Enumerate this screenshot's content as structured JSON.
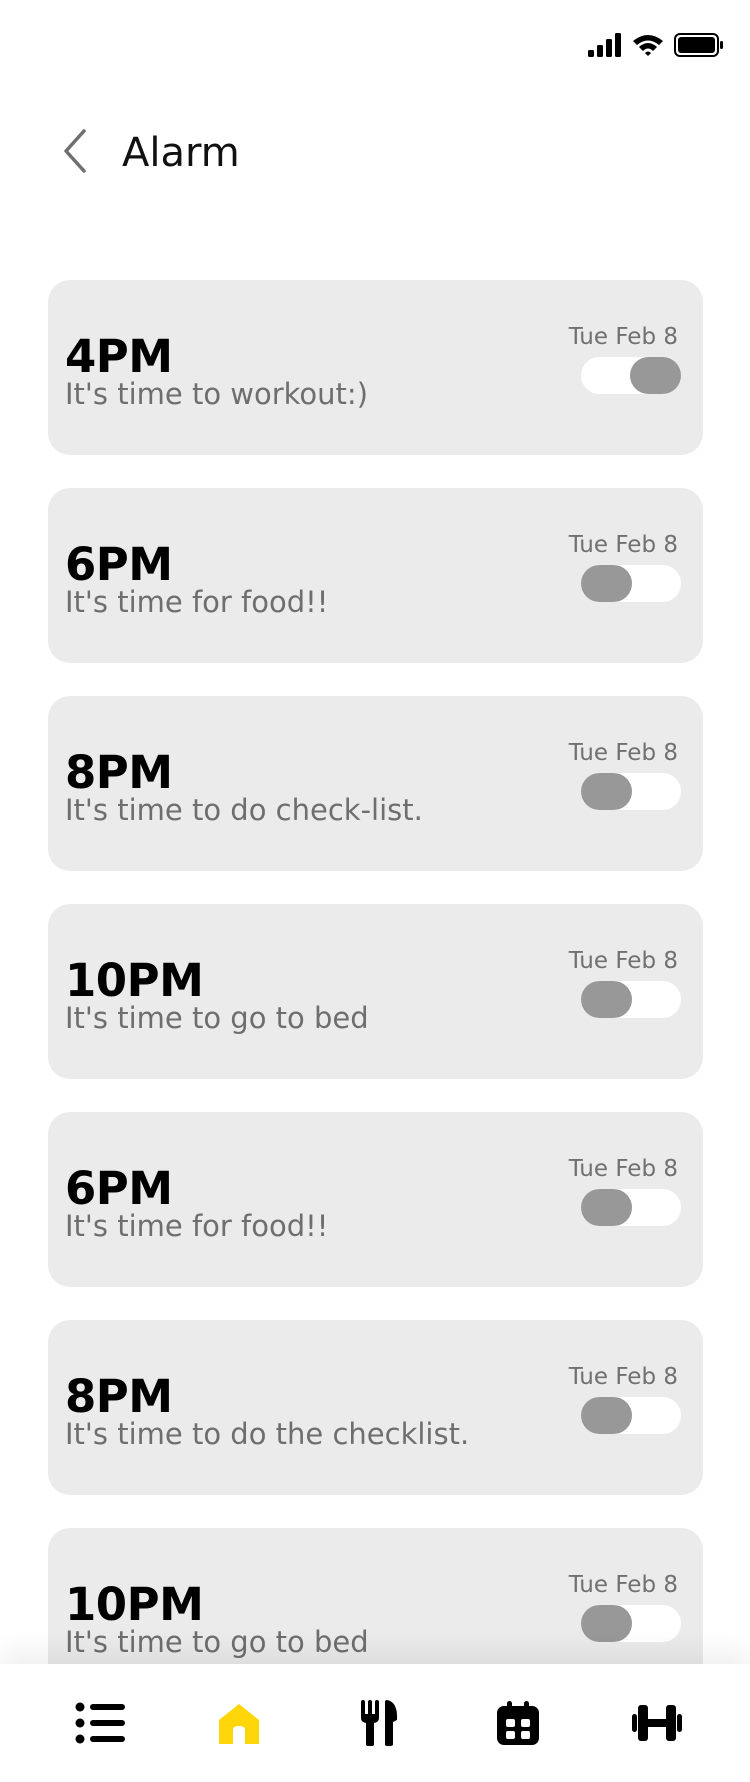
{
  "status_bar": {
    "icons": [
      "signal-icon",
      "wifi-icon",
      "battery-icon"
    ]
  },
  "header": {
    "title": "Alarm",
    "back_icon": "chevron-left-icon"
  },
  "alarms": [
    {
      "time": "4PM",
      "message": "It's time to workout:)",
      "date": "Tue Feb 8",
      "enabled": true
    },
    {
      "time": "6PM",
      "message": "It's time for food!!",
      "date": "Tue Feb 8",
      "enabled": false
    },
    {
      "time": "8PM",
      "message": "It's time to do check-list.",
      "date": "Tue Feb 8",
      "enabled": false
    },
    {
      "time": "10PM",
      "message": "It's time to go to bed",
      "date": "Tue Feb 8",
      "enabled": false
    },
    {
      "time": "6PM",
      "message": "It's time for food!!",
      "date": "Tue Feb 8",
      "enabled": false
    },
    {
      "time": "8PM",
      "message": "It's time to do the checklist.",
      "date": "Tue Feb 8",
      "enabled": false
    },
    {
      "time": "10PM",
      "message": "It's time to go to bed",
      "date": "Tue Feb 8",
      "enabled": false
    }
  ],
  "bottom_nav": {
    "items": [
      {
        "icon": "list-icon",
        "active": false
      },
      {
        "icon": "home-icon",
        "active": true
      },
      {
        "icon": "fork-knife-icon",
        "active": false
      },
      {
        "icon": "calendar-icon",
        "active": false
      },
      {
        "icon": "dumbbell-icon",
        "active": false
      }
    ]
  },
  "colors": {
    "accent": "#FFD60A",
    "card_background": "#EBEBEB",
    "toggle_knob": "#989898",
    "text_primary": "#000000",
    "text_secondary": "#6E6E6E"
  }
}
